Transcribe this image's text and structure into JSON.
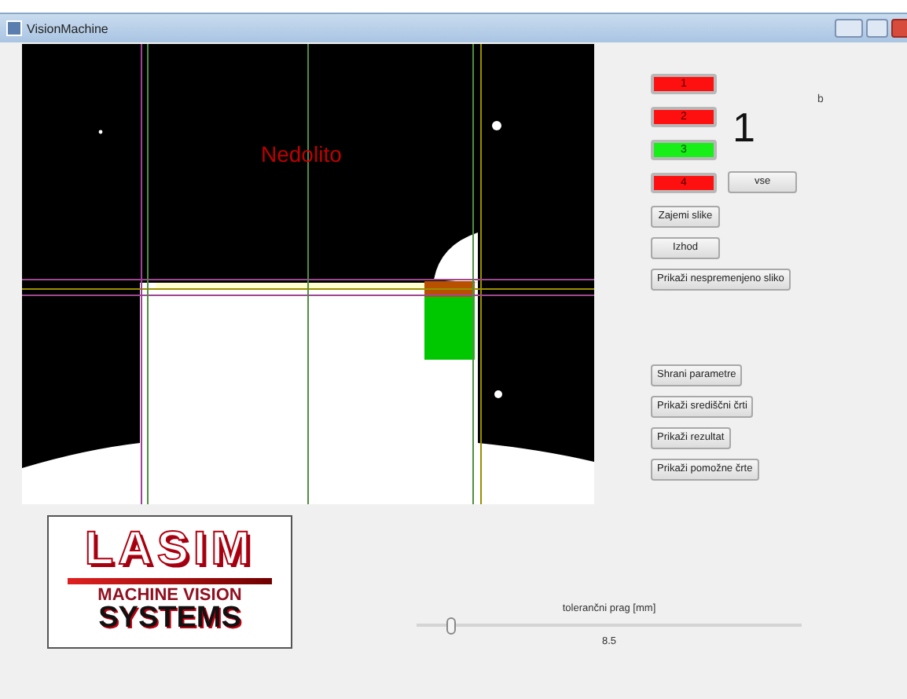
{
  "window": {
    "title": "VisionMachine"
  },
  "camera_view": {
    "kind": "picture",
    "result_label": "Nedolito"
  },
  "indicators": [
    {
      "label": "1",
      "passed": false
    },
    {
      "label": "2",
      "passed": false
    },
    {
      "label": "3",
      "passed": true
    },
    {
      "label": "4",
      "passed": false
    }
  ],
  "count": "1",
  "corner_label": "b",
  "all_button": "vse",
  "buttons_top": [
    "Zajemi slike",
    "Izhod",
    "Prikaži nespremenjeno sliko"
  ],
  "buttons_bottom": [
    "Shrani parametre",
    "Prikaži središčni črti",
    "Prikaži rezultat",
    "Prikaži pomožne črte"
  ],
  "logo": {
    "name": "LASIM",
    "line1": "MACHINE VISION",
    "line2": "SYSTEMS"
  },
  "slider": {
    "label": "tolerančni prag [mm]",
    "level": 0.09,
    "value": "8.5"
  }
}
